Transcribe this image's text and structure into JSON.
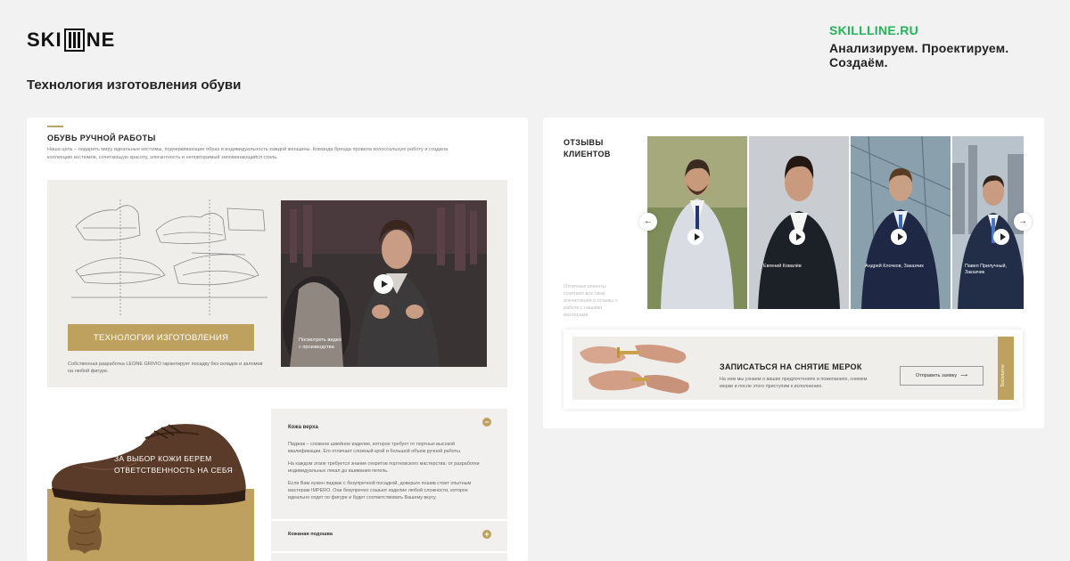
{
  "header": {
    "logo_left": "SKI",
    "logo_right": "NE",
    "site": "SKILLLINE.RU",
    "slogan": "Анализируем. Проектируем. Создаём."
  },
  "page_title": "Технология изготовления обуви",
  "left_card": {
    "section_title": "ОБУВЬ РУЧНОЙ РАБОТЫ",
    "section_desc": "Наша цель – подарить миру идеальные костюмы, подчеркивающие образ и индивидуальность каждой женщины. Команда бренда провела колоссальную работу и создала коллекцию костюмов, сочетающую красоту, элегантность и неповторимый запоминающийся стиль.",
    "tech_button": "ТЕХНОЛОГИИ ИЗГОТОВЛЕНИЯ",
    "tech_note": "Собственная разработка LEONE GRIVIO гарантирует посадку без складок и заломов на любой фигуре.",
    "video_caption_1": "Посмотреть видео",
    "video_caption_2": "с производства",
    "leather_title_1": "ЗА ВЫБОР КОЖИ БЕРЕМ",
    "leather_title_2": "ОТВЕТСТВЕННОСТЬ НА СЕБЯ",
    "accordion": {
      "item1_title": "Кожа верха",
      "item1_paragraphs": [
        "Пиджак – сложное швейное изделие, которое требует от портных высокой квалификации. Его отличает сложный крой и большой объем ручной работы.",
        "На каждом этапе требуется знание секретов портновского мастерства: от разработки индивидуальных лекал до вшивания петель.",
        "Если Вам нужен пиджак с безупречной посадкой, доверьте пошив стоит опытным мастерам IMPERO. Они безупречно сошьют изделие любой сложности, которое идеально сядет по фигуре и будет соответствовать Вашему вкусу."
      ],
      "item1_toggle": "−",
      "item2_title": "Кожаная подошва",
      "item2_toggle": "+"
    }
  },
  "right_card": {
    "reviews_title_1": "ОТЗЫВЫ",
    "reviews_title_2": "КЛИЕНТОВ",
    "reviews_note": "Отличные клиенты сочетают все свои впечатления и отзывы о работе с нашими мастерами.",
    "arrow_left": "←",
    "arrow_right": "→",
    "photo_names": [
      "",
      "Евгений Ковалёв",
      "Андрей Клочков, Заказчик",
      "Павел Прилучный, Заказчик"
    ],
    "measure": {
      "title": "ЗАПИСАТЬСЯ НА СНЯТИЕ МЕРОК",
      "text": "На нем мы узнаем о ваших предпочтениях и пожеланиях, снимем мерки и после этого приступим к исполнению.",
      "button": "Отправить заявку",
      "button_arrow": "⟶",
      "side_label": "Бесплатно"
    }
  },
  "colors": {
    "accent_gold": "#bea15f",
    "brand_green": "#26b35a"
  }
}
